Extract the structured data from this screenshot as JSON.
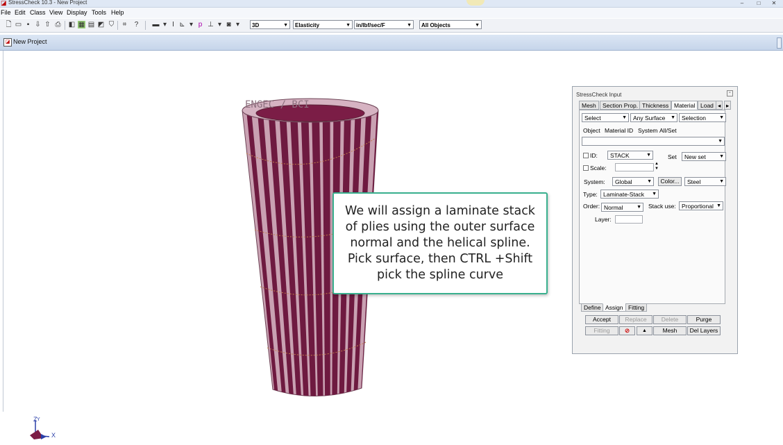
{
  "window": {
    "app_title": "StressCheck 10.3 - New Project",
    "minimize": "–",
    "maximize": "□",
    "close": "✕"
  },
  "menu": [
    "File",
    "Edit",
    "Class",
    "View",
    "Display",
    "Tools",
    "Help"
  ],
  "toolbar": {
    "view_mode": "3D",
    "analysis_type": "Elasticity",
    "units": "in/lbf/sec/F",
    "object_filter": "All Objects"
  },
  "document": {
    "title": "New Project"
  },
  "model_label": "ENGEC / BCI",
  "callout": {
    "text": "We will assign a laminate stack of plies using the outer surface normal and the helical spline. Pick surface, then CTRL +Shift pick the spline curve"
  },
  "axes": {
    "z": "Z",
    "y": "Y",
    "x": "X"
  },
  "input_panel": {
    "title": "StressCheck Input",
    "tabs": [
      "Mesh",
      "Section Prop.",
      "Thickness",
      "Material",
      "Load"
    ],
    "active_tab": "Material",
    "select_mode": "Select",
    "surface_filter": "Any Surface",
    "selection_filter": "Selection",
    "column_headers": [
      "Object",
      "Material ID",
      "System",
      "All/Set"
    ],
    "id_label": "ID:",
    "id_value": "STACK",
    "set_label": "Set",
    "set_value": "New set",
    "scale_label": "Scale:",
    "system_label": "System:",
    "system_value": "Global",
    "color_button": "Color...",
    "material_value": "Steel",
    "type_label": "Type:",
    "type_value": "Laminate-Stack",
    "order_label": "Order:",
    "order_value": "Normal",
    "stack_use_label": "Stack use:",
    "stack_use_value": "Proportional",
    "layer_label": "Layer:",
    "bottom_tabs": [
      "Define",
      "Assign",
      "Fitting"
    ],
    "active_bottom_tab": "Assign",
    "buttons": {
      "accept": "Accept",
      "replace": "Replace",
      "delete": "Delete",
      "purge": "Purge",
      "fitting": "Fitting",
      "mesh": "Mesh",
      "del_layers": "Del Layers"
    }
  }
}
